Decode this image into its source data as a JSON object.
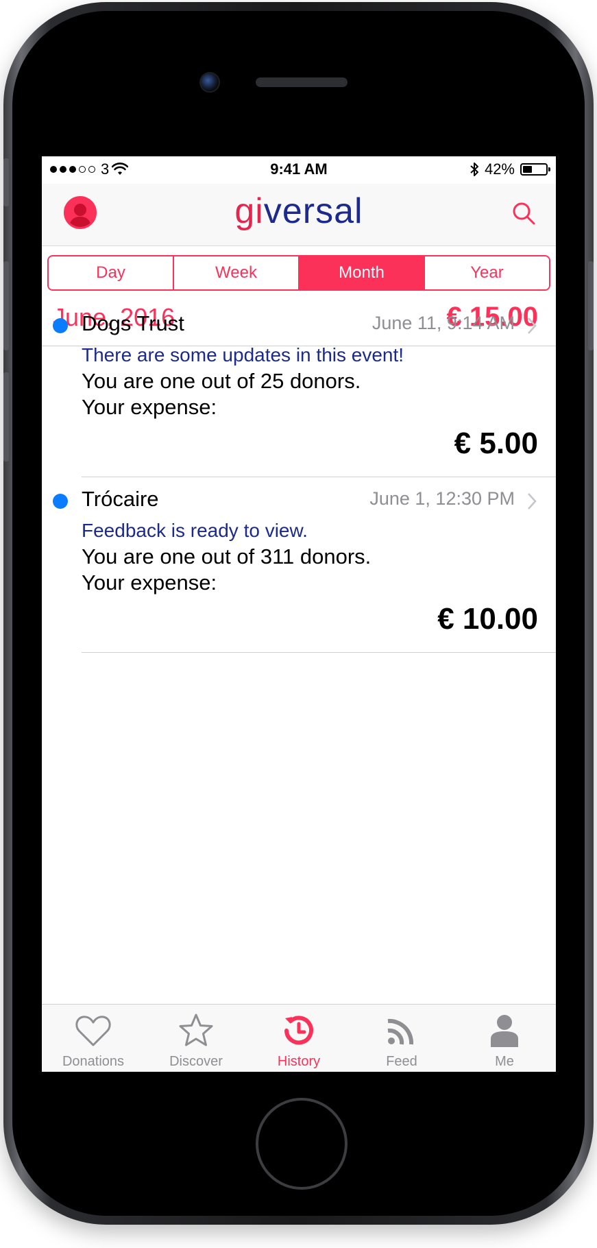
{
  "status_bar": {
    "signal_dots": 5,
    "signal_filled": 3,
    "carrier": "3",
    "time": "9:41 AM",
    "battery_percent": "42%",
    "battery_level": 0.42
  },
  "nav": {
    "logo_accent": "gi",
    "logo_rest": "versal",
    "left_icon": "profile-icon",
    "right_icon": "search-icon"
  },
  "segments": [
    {
      "label": "Day",
      "active": false
    },
    {
      "label": "Week",
      "active": false
    },
    {
      "label": "Month",
      "active": true
    },
    {
      "label": "Year",
      "active": false
    }
  ],
  "period": {
    "label": "June, 2016",
    "total": "€ 15.00"
  },
  "events": [
    {
      "title": "Dogs Trust",
      "when": "June 11, 9:14 AM",
      "update": "There are some updates in this event!",
      "donors": "You are one out of 25 donors.",
      "expense_label": "Your expense:",
      "amount": "€ 5.00"
    },
    {
      "title": "Trócaire",
      "when": "June 1, 12:30 PM",
      "update": "Feedback is ready to view.",
      "donors": "You are one out of 311 donors.",
      "expense_label": "Your expense:",
      "amount": "€ 10.00"
    }
  ],
  "tabs": [
    {
      "label": "Donations",
      "icon": "heart-icon",
      "active": false
    },
    {
      "label": "Discover",
      "icon": "star-icon",
      "active": false
    },
    {
      "label": "History",
      "icon": "history-icon",
      "active": true
    },
    {
      "label": "Feed",
      "icon": "rss-icon",
      "active": false
    },
    {
      "label": "Me",
      "icon": "person-icon",
      "active": false
    }
  ],
  "colors": {
    "accent": "#fb3159",
    "logo_blue": "#1b2a8c",
    "unread_dot": "#0a7cff",
    "inactive_gray": "#8e8e93"
  }
}
